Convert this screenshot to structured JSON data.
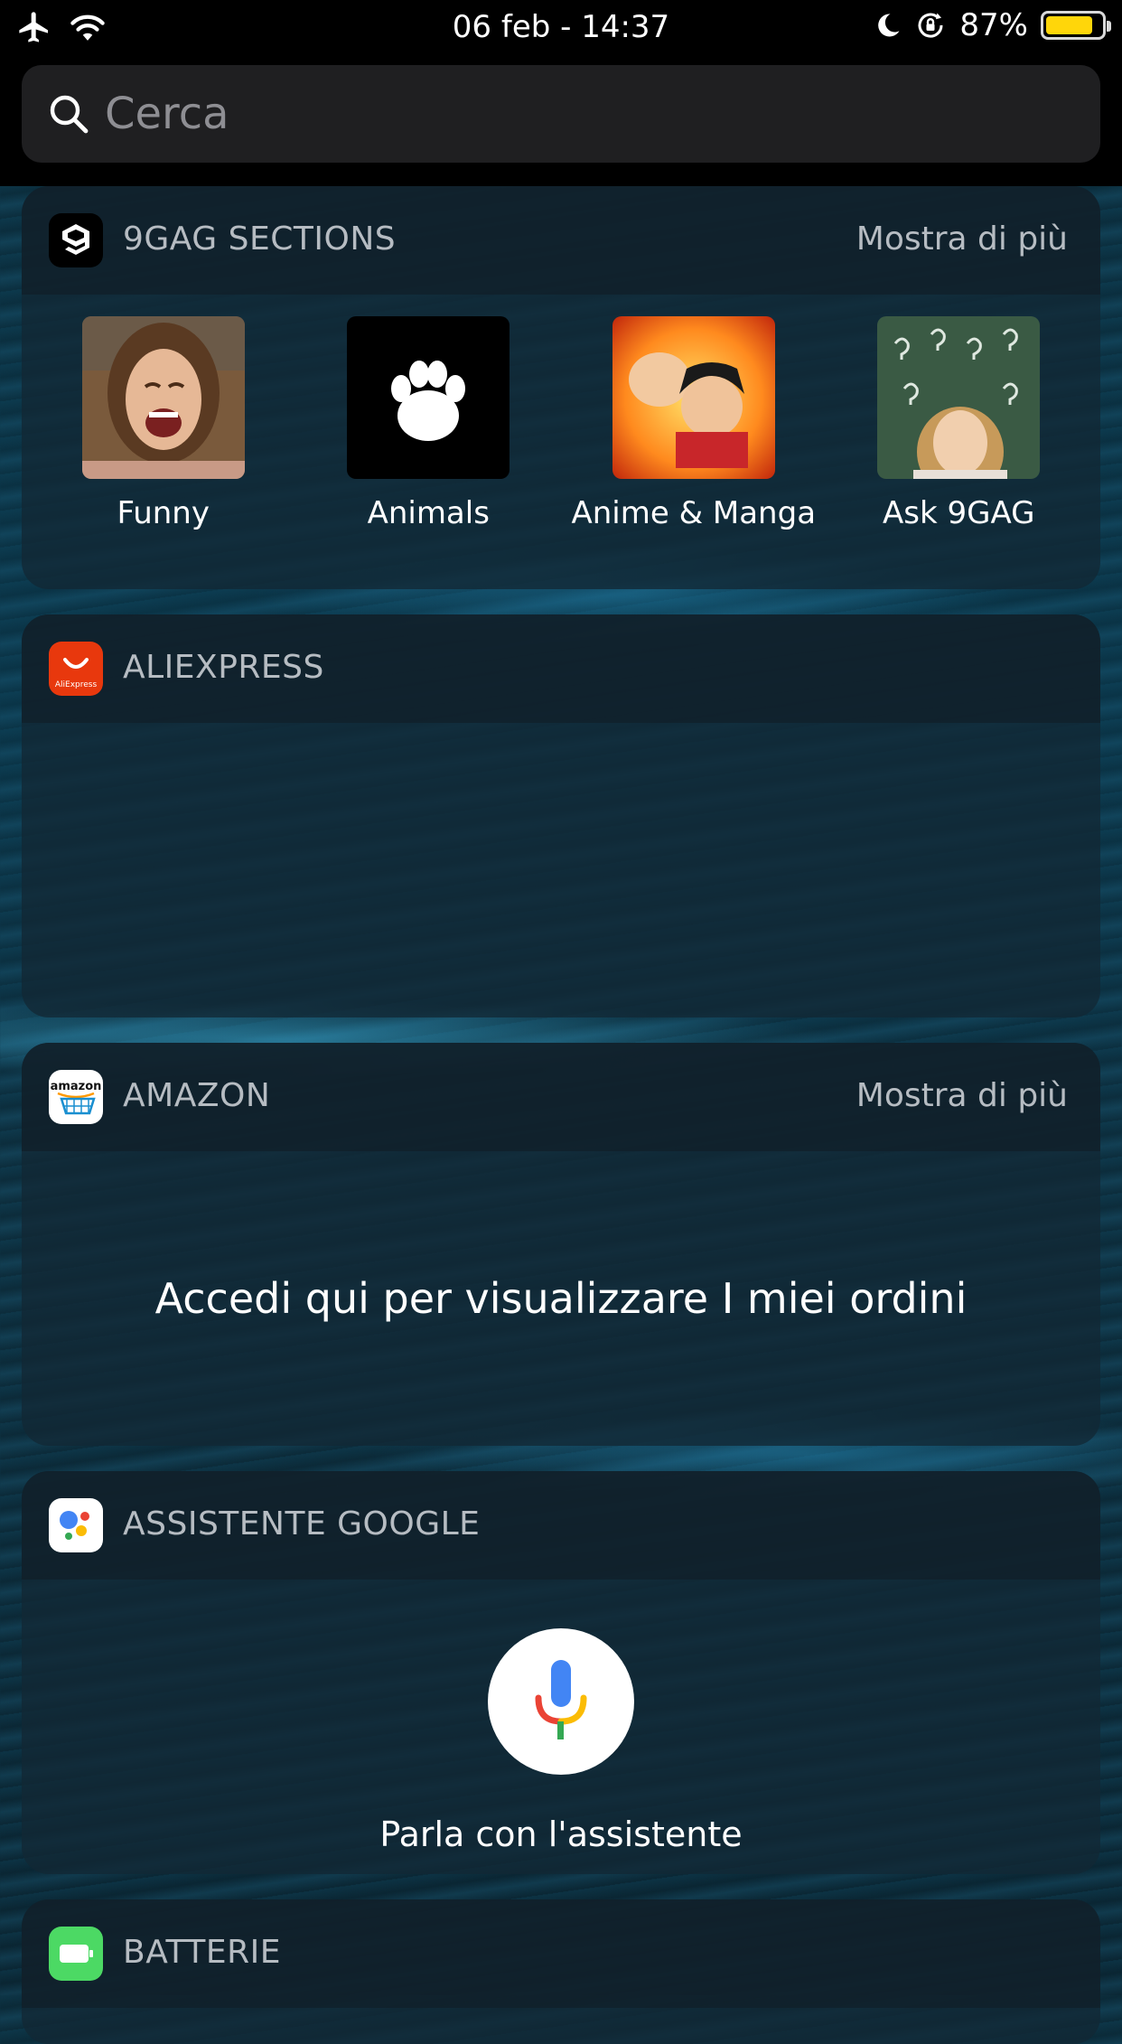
{
  "status_bar": {
    "datetime": "06 feb - 14:37",
    "battery_percent": "87%",
    "battery_level": 0.87
  },
  "search": {
    "placeholder": "Cerca"
  },
  "widgets": {
    "ninegag": {
      "title": "9GAG SECTIONS",
      "more": "Mostra di più",
      "sections": [
        {
          "label": "Funny"
        },
        {
          "label": "Animals"
        },
        {
          "label": "Anime & Manga"
        },
        {
          "label": "Ask 9GAG"
        }
      ]
    },
    "aliexpress": {
      "title": "ALIEXPRESS",
      "icon_text": "AliExpress"
    },
    "amazon": {
      "title": "AMAZON",
      "more": "Mostra di più",
      "message": "Accedi qui per visualizzare I miei ordini",
      "icon_text": "amazon"
    },
    "google_assistant": {
      "title": "ASSISTENTE GOOGLE",
      "action": "Parla con l'assistente"
    },
    "batteries": {
      "title": "BATTERIE"
    }
  },
  "colors": {
    "battery_fill": "#ffd60a",
    "aliexpress_red": "#e8380d",
    "google_blue": "#4285f4",
    "google_red": "#ea4335",
    "google_yellow": "#fbbc05",
    "google_green": "#34a853",
    "battery_widget_green": "#4cd964"
  }
}
